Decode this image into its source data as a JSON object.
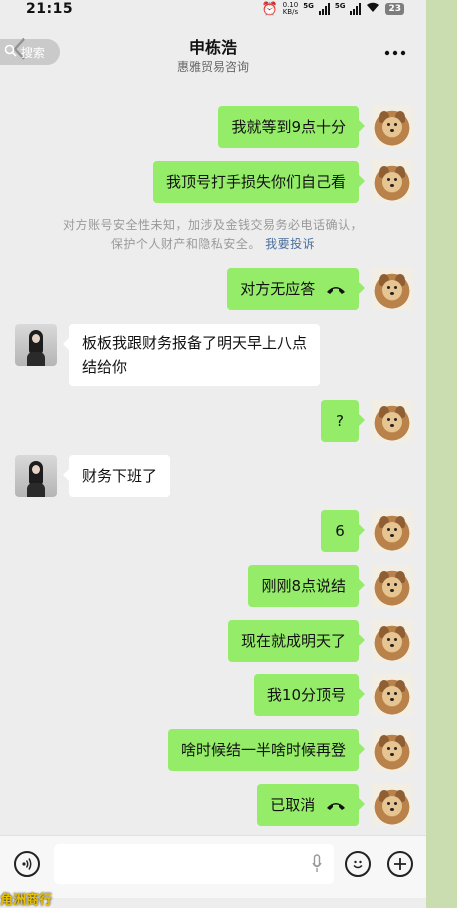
{
  "status_bar": {
    "time": "21:15",
    "speed_value": "0.10",
    "speed_unit": "KB/s",
    "sim1": "5G",
    "sim2": "5G",
    "battery": "23"
  },
  "header": {
    "back_icon": "chevron-left-icon",
    "search_label": "搜索",
    "title": "申栋浩",
    "subtitle": "惠雅贸易咨询",
    "more_icon": "more-horizontal-icon"
  },
  "messages": [
    {
      "side": "out",
      "text": "我就等到9点十分"
    },
    {
      "side": "out",
      "text": "我顶号打手损失你们自己看"
    },
    {
      "side": "out",
      "text": "对方无应答",
      "icon": "call-icon"
    },
    {
      "side": "in",
      "line1": "板板我跟财务报备了明天早上八点",
      "line2": "结给你"
    },
    {
      "side": "out",
      "text": "?"
    },
    {
      "side": "in",
      "text": "财务下班了"
    },
    {
      "side": "out",
      "text": "6"
    },
    {
      "side": "out",
      "text": "刚刚8点说结"
    },
    {
      "side": "out",
      "text": "现在就成明天了"
    },
    {
      "side": "out",
      "text": "我10分顶号"
    },
    {
      "side": "out",
      "text": "啥时候结一半啥时候再登"
    },
    {
      "side": "out",
      "text": "已取消",
      "icon": "call-icon"
    }
  ],
  "system_notice": {
    "line1": "对方账号安全性未知，加涉及金钱交易务必电话确认，",
    "line2": "保护个人财产和隐私安全。",
    "link": "我要投诉"
  },
  "input_bar": {
    "voice_icon": "voice-icon",
    "mic_icon": "mic-icon",
    "emoji_icon": "emoji-icon",
    "plus_icon": "plus-icon"
  },
  "watermark": "角洲商行",
  "colors": {
    "bubble_out": "#95ec69",
    "bubble_in": "#ffffff",
    "background": "#ededed",
    "link": "#4b6e9e"
  }
}
